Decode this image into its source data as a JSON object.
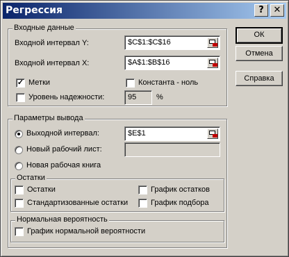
{
  "window": {
    "title": "Регрессия",
    "help_glyph": "?",
    "close_glyph": "✕"
  },
  "input_group": {
    "title": "Входные данные",
    "y_label": "Входной интервал Y:",
    "y_value": "$C$1:$C$16",
    "x_label": "Входной интервал X:",
    "x_value": "$A$1:$B$16",
    "labels_checkbox": "Метки",
    "labels_checked": true,
    "constant_checkbox": "Константа - ноль",
    "constant_checked": false,
    "confidence_checkbox": "Уровень надежности:",
    "confidence_checked": false,
    "confidence_value": "95",
    "confidence_unit": "%"
  },
  "output_group": {
    "title": "Параметры вывода",
    "output_range_label": "Выходной интервал:",
    "output_range_value": "$E$1",
    "output_range_selected": true,
    "new_sheet_label": "Новый рабочий лист:",
    "new_sheet_value": "",
    "new_workbook_label": "Новая рабочая книга"
  },
  "residuals_group": {
    "title": "Остатки",
    "residuals": "Остатки",
    "standardized": "Стандартизованные остатки",
    "residual_plots": "График остатков",
    "line_fit_plots": "График подбора"
  },
  "normal_group": {
    "title": "Нормальная вероятность",
    "normal_plot": "График нормальной вероятности"
  },
  "buttons": {
    "ok": "ОК",
    "cancel": "Отмена",
    "help": "Справка"
  },
  "icons": [
    "help-icon",
    "close-icon",
    "collapse-range-icon"
  ]
}
